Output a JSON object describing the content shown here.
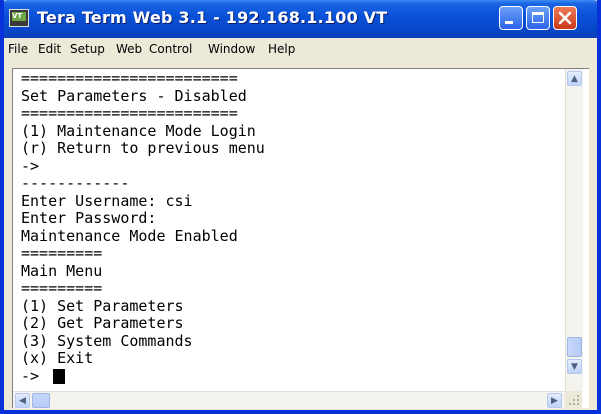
{
  "window": {
    "title": "Tera Term Web 3.1 - 192.168.1.100 VT"
  },
  "menu": [
    "File",
    "Edit",
    "Setup",
    "Web",
    "Control",
    "Window",
    "Help"
  ],
  "terminal": {
    "lines": [
      "========================",
      "Set Parameters - Disabled",
      "========================",
      "(1) Maintenance Mode Login",
      "(r) Return to previous menu",
      "->",
      "------------",
      "Enter Username: csi",
      "Enter Password:",
      "Maintenance Mode Enabled",
      "=========",
      "Main Menu",
      "=========",
      "(1) Set Parameters",
      "(2) Get Parameters",
      "(3) System Commands",
      "(x) Exit",
      "->"
    ]
  },
  "scrollbars": {
    "vertical_position": 1.0,
    "horizontal_position": 0.0
  },
  "icons": {
    "app": "tera-term-icon",
    "minimize": "minimize-icon",
    "maximize": "maximize-icon",
    "close": "close-icon"
  }
}
